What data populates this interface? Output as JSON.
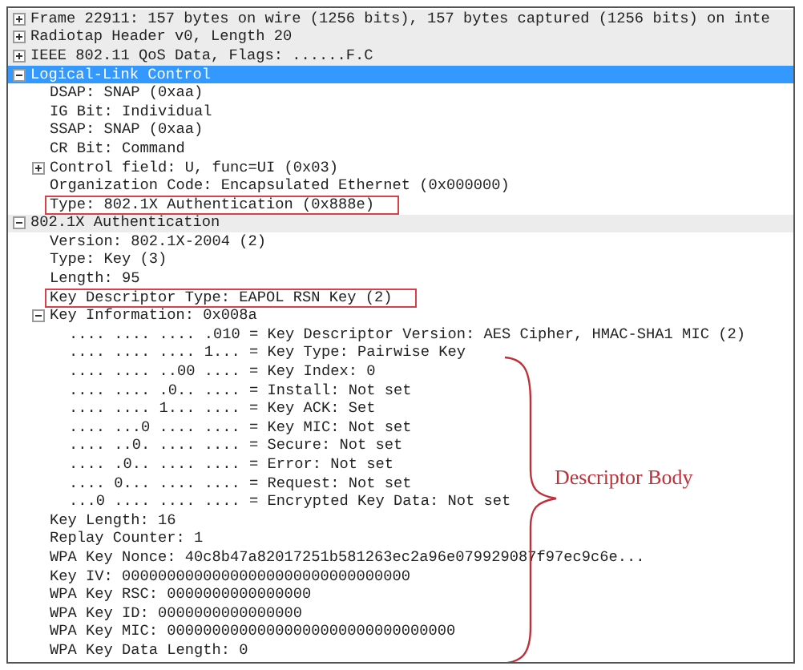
{
  "tree": [
    {
      "text": "Frame 22911: 157 bytes on wire (1256 bits), 157 bytes captured (1256 bits) on inte",
      "expanded": false,
      "selected": false
    },
    {
      "text": "Radiotap Header v0, Length 20",
      "expanded": false,
      "selected": false
    },
    {
      "text": "IEEE 802.11 QoS Data, Flags: ......F.C",
      "expanded": false,
      "selected": false
    },
    {
      "text": "Logical-Link Control",
      "expanded": true,
      "selected": true,
      "children": [
        {
          "text": "DSAP: SNAP (0xaa)"
        },
        {
          "text": "IG Bit: Individual"
        },
        {
          "text": "SSAP: SNAP (0xaa)"
        },
        {
          "text": "CR Bit: Command"
        },
        {
          "text": "Control field: U, func=UI (0x03)",
          "expanded": false,
          "selected": false
        },
        {
          "text": "Organization Code: Encapsulated Ethernet (0x000000)"
        },
        {
          "text": "Type: 802.1X Authentication (0x888e)",
          "boxed": true
        }
      ]
    },
    {
      "text": "802.1X Authentication",
      "expanded": true,
      "selected": false,
      "children": [
        {
          "text": "Version: 802.1X-2004 (2)"
        },
        {
          "text": "Type: Key (3)"
        },
        {
          "text": "Length: 95"
        },
        {
          "text": "Key Descriptor Type: EAPOL RSN Key (2)",
          "boxed": true
        },
        {
          "text": "Key Information: 0x008a",
          "expanded": true,
          "selected": false,
          "children": [
            {
              "text": ".... .... .... .010 = Key Descriptor Version: AES Cipher, HMAC-SHA1 MIC (2)"
            },
            {
              "text": ".... .... .... 1... = Key Type: Pairwise Key"
            },
            {
              "text": ".... .... ..00 .... = Key Index: 0"
            },
            {
              "text": ".... .... .0.. .... = Install: Not set"
            },
            {
              "text": ".... .... 1... .... = Key ACK: Set"
            },
            {
              "text": ".... ...0 .... .... = Key MIC: Not set"
            },
            {
              "text": ".... ..0. .... .... = Secure: Not set"
            },
            {
              "text": ".... .0.. .... .... = Error: Not set"
            },
            {
              "text": ".... 0... .... .... = Request: Not set"
            },
            {
              "text": "...0 .... .... .... = Encrypted Key Data: Not set"
            }
          ]
        },
        {
          "text": "Key Length: 16"
        },
        {
          "text": "Replay Counter: 1"
        },
        {
          "text": "WPA Key Nonce: 40c8b47a82017251b581263ec2a96e079929087f97ec9c6e..."
        },
        {
          "text": "Key IV: 00000000000000000000000000000000"
        },
        {
          "text": "WPA Key RSC: 0000000000000000"
        },
        {
          "text": "WPA Key ID: 0000000000000000"
        },
        {
          "text": "WPA Key MIC: 00000000000000000000000000000000"
        },
        {
          "text": "WPA Key Data Length: 0"
        }
      ]
    }
  ],
  "annotation": {
    "label": "Descriptor Body"
  }
}
